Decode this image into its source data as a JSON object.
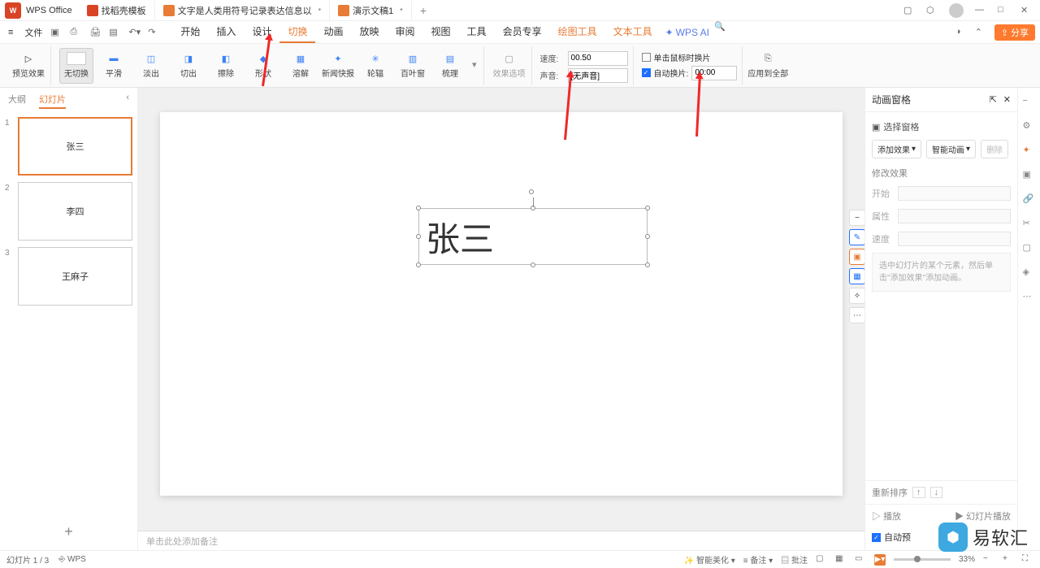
{
  "titlebar": {
    "brand": "WPS Office",
    "tabs": [
      {
        "label": "找稻壳模板",
        "icon": "red"
      },
      {
        "label": "文字是人类用符号记录表达信息以",
        "icon": "orange",
        "dirty": "•"
      },
      {
        "label": "演示文稿1",
        "icon": "orange",
        "dirty": "•",
        "active": true
      }
    ],
    "add": "+"
  },
  "menubar": {
    "file": "文件",
    "items": [
      "开始",
      "插入",
      "设计",
      "切换",
      "动画",
      "放映",
      "审阅",
      "视图",
      "工具",
      "会员专享"
    ],
    "active_index": 3,
    "extras": [
      "绘图工具",
      "文本工具"
    ],
    "ai": "WPS AI",
    "share": "分享"
  },
  "ribbon": {
    "preview": "预览效果",
    "transitions": [
      "无切换",
      "平滑",
      "淡出",
      "切出",
      "擦除",
      "形状",
      "溶解",
      "新闻快报",
      "轮辐",
      "百叶窗",
      "梳理"
    ],
    "effect_opts": "效果选项",
    "speed_label": "速度:",
    "speed_value": "00.50",
    "sound_label": "声音:",
    "sound_value": "[无声音]",
    "chk_click": "单击鼠标时换片",
    "chk_auto": "自动换片:",
    "auto_value": "00:00",
    "apply_all": "应用到全部"
  },
  "thumbs": {
    "tab_outline": "大纲",
    "tab_slides": "幻灯片",
    "collapse": "‹",
    "slides": [
      {
        "num": "1",
        "title": "张三",
        "active": true
      },
      {
        "num": "2",
        "title": "李四"
      },
      {
        "num": "3",
        "title": "王麻子"
      }
    ],
    "add": "+"
  },
  "canvas": {
    "textbox": "张三",
    "notes_placeholder": "单击此处添加备注"
  },
  "rpanel": {
    "title": "动画窗格",
    "select": "选择窗格",
    "btn_add": "添加效果",
    "btn_smart": "智能动画",
    "btn_del": "删除",
    "section": "修改效果",
    "prop_start": "开始",
    "prop_attr": "属性",
    "prop_speed": "速度",
    "hint": "选中幻灯片的某个元素，然后单击\"添加效果\"添加动画。",
    "reorder": "重新排序",
    "play": "播放",
    "slideshow": "幻灯片播放",
    "autopreview": "自动预"
  },
  "status": {
    "slide_pos": "幻灯片 1 / 3",
    "wps": "WPS",
    "beautify": "智能美化",
    "notes": "备注",
    "comments": "批注",
    "zoom": "33%"
  },
  "watermark": "易软汇",
  "chart_data": null
}
